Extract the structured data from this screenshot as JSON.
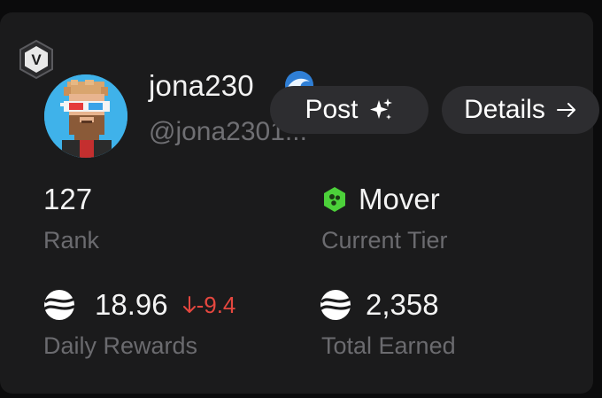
{
  "profile": {
    "badge_letter": "V",
    "username": "jona230",
    "handle": "@jona2301..."
  },
  "actions": {
    "post_label": "Post",
    "details_label": "Details"
  },
  "stats": {
    "rank": {
      "value": "127",
      "label": "Rank"
    },
    "tier": {
      "value": "Mover",
      "label": "Current Tier",
      "color": "#4cd13a"
    },
    "daily": {
      "value": "18.96",
      "delta": "-9.4",
      "label": "Daily Rewards"
    },
    "total": {
      "value": "2,358",
      "label": "Total Earned"
    }
  },
  "colors": {
    "negative": "#e5473f",
    "muted": "#6b6b6f",
    "button_bg": "#2d2d30",
    "card_bg": "#1b1b1c"
  },
  "icons": [
    "v-badge-icon",
    "wave-icon",
    "sparkle-icon",
    "arrow-right-icon",
    "tier-gem-icon",
    "token-icon",
    "arrow-down-icon"
  ]
}
